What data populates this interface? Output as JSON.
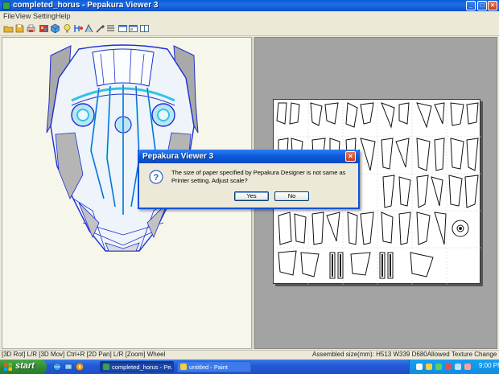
{
  "window": {
    "title": "completed_horus - Pepakura Viewer 3",
    "controls": {
      "minimize": "_",
      "maximize": "□",
      "close": "×"
    }
  },
  "menu": [
    "File",
    "View",
    "Setting",
    "Help"
  ],
  "toolbar": {
    "icons": [
      "open-icon",
      "save-icon",
      "print-icon",
      "texture-icon",
      "3d-view-icon",
      "lightbulb-icon",
      "assembly-icon",
      "edge-icon",
      "tools-icon",
      "layout-icon",
      "window-icon",
      "panel-icon",
      "split-view-icon"
    ]
  },
  "status": {
    "left": "[3D Rot] L/R [3D Mov] Ctrl+R [2D Pan] L/R [Zoom] Wheel",
    "right": "Assembled size(mm): H513 W339 D680Allowed Texture Change"
  },
  "dialog": {
    "title": "Pepakura Viewer 3",
    "message": "The size of paper specified by Pepakura Designer is not same as Printer setting. Adjust scale?",
    "yes": "Yes",
    "no": "No",
    "close": "×"
  },
  "taskbar": {
    "start": "start",
    "tasks": [
      {
        "label": "completed_horus - Pe...",
        "active": true
      },
      {
        "label": "untitled - Paint",
        "active": false
      }
    ],
    "clock": "9:00 PM"
  },
  "colors": {
    "titlebar": "#0a5fd8",
    "model_outline": "#1b2fd0",
    "model_accent": "#33c3e8",
    "model_fill": "#a9a9a9",
    "workspace_gray": "#a3a3a3",
    "taskbar": "#2459d6",
    "start_green": "#3a9a3c"
  }
}
